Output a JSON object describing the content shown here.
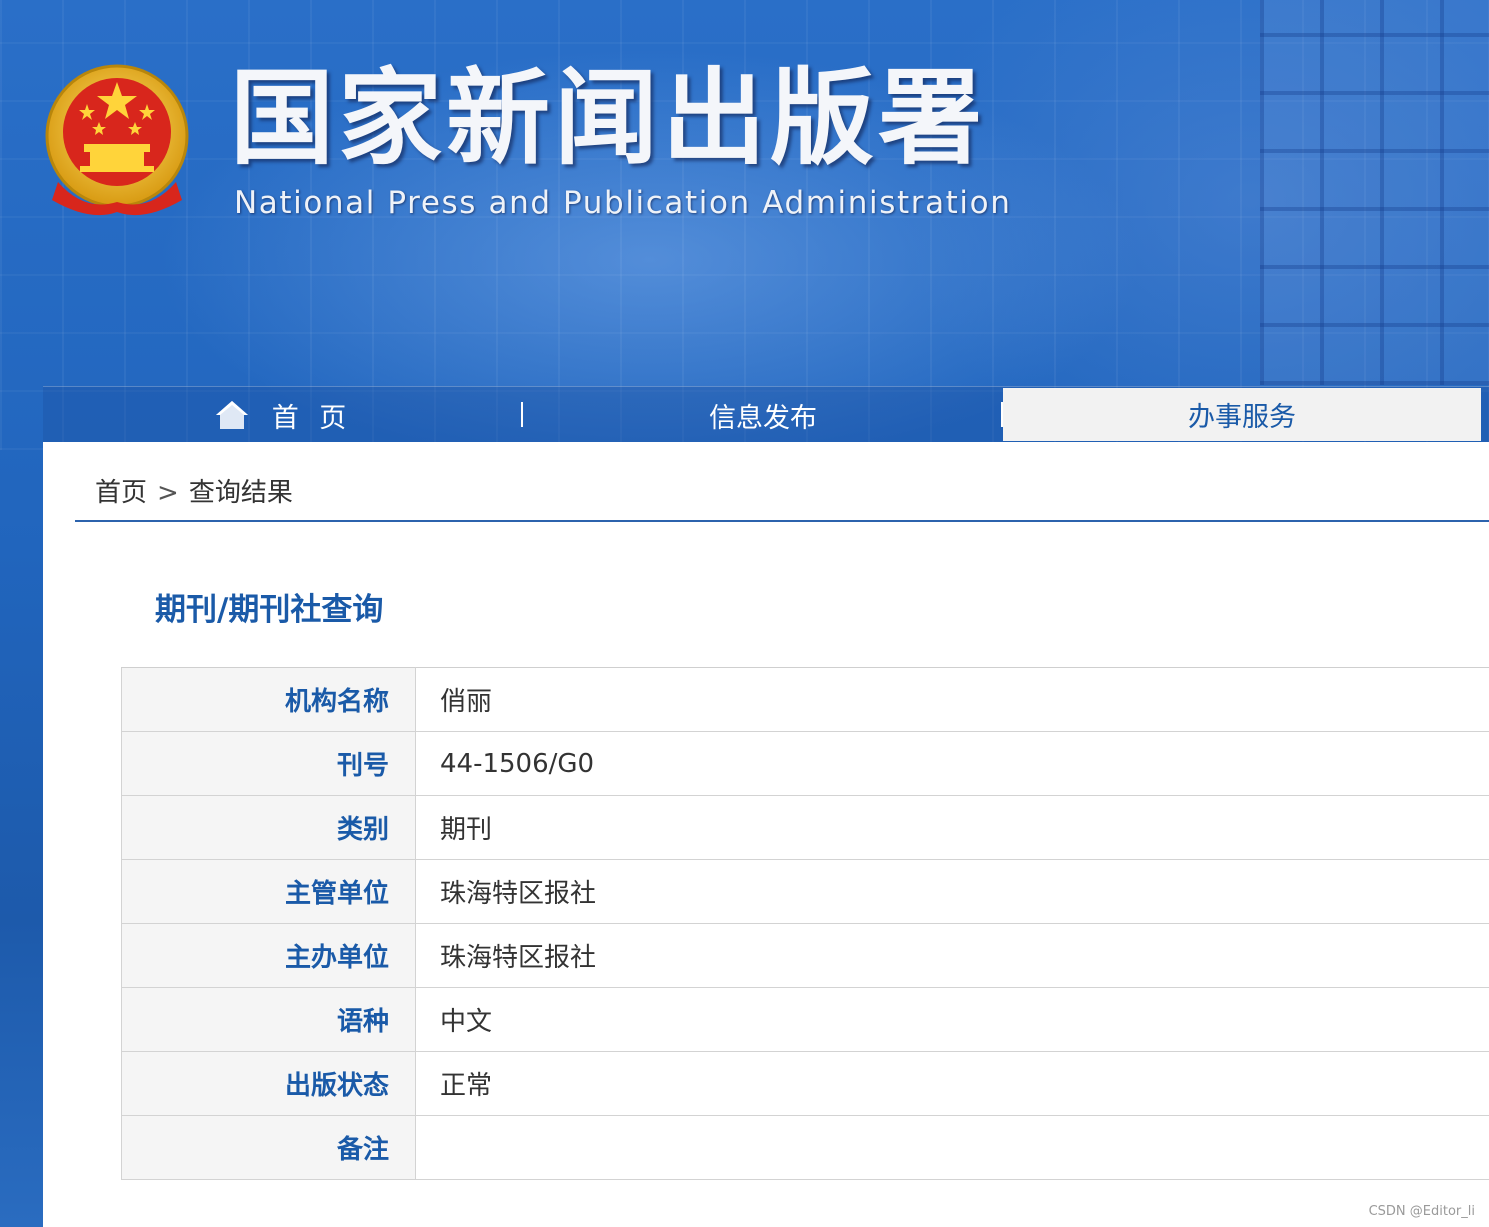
{
  "header": {
    "title": "国家新闻出版署",
    "subtitle": "National  Press and Publication Administration"
  },
  "nav": {
    "home_icon": "home-icon",
    "home": "首 页",
    "info": "信息发布",
    "service": "办事服务"
  },
  "breadcrumb": {
    "home": "首页",
    "separator": ">",
    "current": "查询结果"
  },
  "section": {
    "title": "期刊/期刊社查询"
  },
  "table": {
    "rows": [
      {
        "label": "机构名称",
        "value": "俏丽"
      },
      {
        "label": "刊号",
        "value": "44-1506/G0"
      },
      {
        "label": "类别",
        "value": "期刊"
      },
      {
        "label": "主管单位",
        "value": "珠海特区报社"
      },
      {
        "label": "主办单位",
        "value": "珠海特区报社"
      },
      {
        "label": "语种",
        "value": "中文"
      },
      {
        "label": "出版状态",
        "value": "正常"
      },
      {
        "label": "备注",
        "value": ""
      }
    ]
  },
  "watermark": "CSDN @Editor_li",
  "colors": {
    "accent": "#1a5aa8",
    "header_bg": "#2165bd",
    "label_bg": "#f5f5f5"
  }
}
